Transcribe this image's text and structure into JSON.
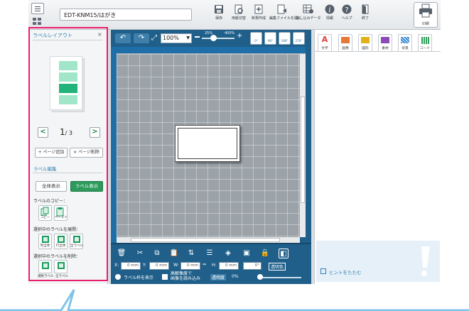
{
  "toolbar": {
    "doc_title": "EDT-KNM15/はがき",
    "items": [
      {
        "label": "保存"
      },
      {
        "label": "用紙切替"
      },
      {
        "label": "新規作成"
      },
      {
        "label": "編集ファイルを開く"
      },
      {
        "label": "差し込みデータ"
      },
      {
        "label": "情報"
      },
      {
        "label": "ヘルプ"
      },
      {
        "label": "終了"
      }
    ],
    "print_label": "印刷"
  },
  "left_panel": {
    "title": "ラベルレイアウト",
    "close_glyph": "×",
    "page_current": "1",
    "page_total": "/ 3",
    "prev_glyph": "<",
    "next_glyph": ">",
    "add_page_label": "+ ページ追加",
    "delete_page_label": "× ページ削除",
    "label_edit_heading": "ラベル編集",
    "view_all_label": "全体表示",
    "view_label_label": "ラベル表示",
    "copy_heading": "ラベルのコピー：",
    "copy_label": "コピー",
    "paste_label": "ペースト",
    "expand_heading": "選択中のラベルを展開：",
    "expand_items": [
      "列全体",
      "行全体",
      "全ラベル"
    ],
    "delete_heading": "選択中のラベルを削除：",
    "delete_items": [
      "選択ラベル",
      "全ラベル"
    ]
  },
  "canvas": {
    "zoom_value": "100%",
    "zoom_min_label": "25%",
    "zoom_max_label": "400%",
    "rotate_labels": [
      "0°",
      "90°",
      "180°",
      "270°"
    ],
    "x_label": "X:",
    "x_value": "0 mm",
    "y_label": "Y:",
    "y_value": "0 mm",
    "w_label": "W:",
    "w_value": "0 mm",
    "h_label": "H:",
    "h_value": "0 mm",
    "angle_value": "0°",
    "transparent_color_label": "透明色",
    "show_frame_label": "ラベル枠を表示",
    "hires_label_line1": "高解像度で",
    "hires_label_line2": "画像を読み込み",
    "transparency_label": "透明度",
    "transparency_value": "0%"
  },
  "right_panel": {
    "tabs": [
      {
        "label": "文字",
        "color": "#e0403a"
      },
      {
        "label": "画像",
        "color": "#e6783a"
      },
      {
        "label": "図形",
        "color": "#e0b21a"
      },
      {
        "label": "素材",
        "color": "#8a4bb8"
      },
      {
        "label": "背景",
        "color": "#3a8ad0"
      },
      {
        "label": "コード",
        "color": "#2f9e5a"
      }
    ],
    "hint_label": "ヒントをたたむ"
  },
  "colors": {
    "highlight": "#ea1d6e",
    "canvas_chrome": "#1f5f8a",
    "selected_label": "#21b37a",
    "label_cell": "#a2e6c9",
    "accent_green": "#2b9a5b"
  }
}
